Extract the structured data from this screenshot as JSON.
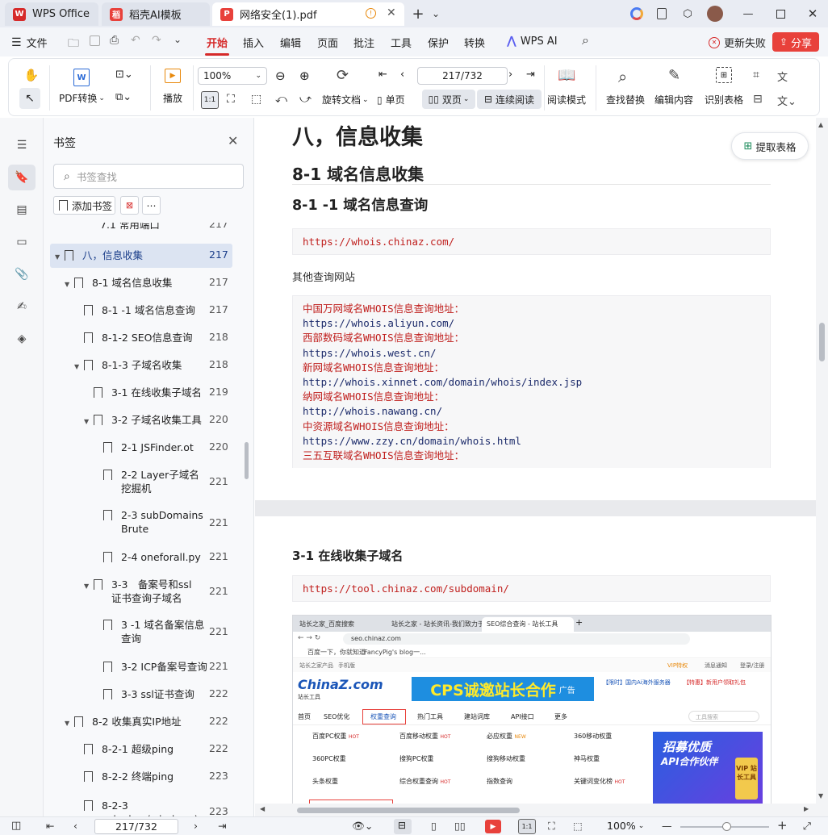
{
  "titlebar": {
    "tabs": [
      {
        "label": "WPS Office",
        "color": "#d62a2a"
      },
      {
        "label": "稻壳AI模板",
        "color": "#e8413b"
      },
      {
        "label": "网络安全(1).pdf",
        "color": "#e8413b"
      }
    ],
    "new_tab": "+",
    "dropdown": "⌄"
  },
  "menubar": {
    "file": "文件",
    "items": [
      "开始",
      "插入",
      "编辑",
      "页面",
      "批注",
      "工具",
      "保护",
      "转换"
    ],
    "active": "开始",
    "wps_ai": "WPS AI",
    "update_failed": "更新失败",
    "share": "分享"
  },
  "toolbar": {
    "pdf_convert": "PDF转换",
    "play": "播放",
    "zoom": "100%",
    "page_input": "217/732",
    "rotate": "旋转文档",
    "single_page": "单页",
    "double_page": "双页",
    "continuous": "连续阅读",
    "reading_mode": "阅读模式",
    "find_replace": "查找替换",
    "edit_content": "编辑内容",
    "recognize_table": "识别表格"
  },
  "panel": {
    "title": "书签",
    "search_placeholder": "书签查找",
    "add_bookmark": "添加书签",
    "items": [
      {
        "label": "7.1 常用端口",
        "page": "217"
      },
      {
        "label": "八，信息收集",
        "page": "217"
      },
      {
        "label": "8-1 域名信息收集",
        "page": "217"
      },
      {
        "label": "8-1 -1 域名信息查询",
        "page": "217"
      },
      {
        "label": "8-1-2 SEO信息查询",
        "page": "218"
      },
      {
        "label": "8-1-3 子域名收集",
        "page": "218"
      },
      {
        "label": "3-1 在线收集子域名",
        "page": "219"
      },
      {
        "label": "3-2 子域名收集工具",
        "page": "220"
      },
      {
        "label": "2-1 JSFinder.ot",
        "page": "220"
      },
      {
        "label": "2-2 Layer子域名挖掘机",
        "page": "221"
      },
      {
        "label": "2-3 subDomainsBrute",
        "page": "221"
      },
      {
        "label": "2-4 oneforall.py",
        "page": "221"
      },
      {
        "label": "3-3　备案号和ssl证书查询子域名",
        "page": "221"
      },
      {
        "label": "3 -1 域名备案信息查询",
        "page": "221"
      },
      {
        "label": "3-2 ICP备案号查询",
        "page": "221"
      },
      {
        "label": "3-3 ssl证书查询",
        "page": "222"
      },
      {
        "label": "8-2 收集真实IP地址",
        "page": "222"
      },
      {
        "label": "8-2-1 超级ping",
        "page": "222"
      },
      {
        "label": "8-2-2 终端ping",
        "page": "223"
      },
      {
        "label": "8-2-3 nslookup(windows)",
        "page": "223"
      }
    ]
  },
  "doc": {
    "h1": "八，信息收集",
    "h2": "8-1 域名信息收集",
    "h3": "8-1 -1 域名信息查询",
    "url1": "https://whois.chinaz.com/",
    "other_sites": "其他查询网站",
    "whois_lines": [
      "中国万网域名WHOIS信息查询地址：",
      "https://whois.aliyun.com/",
      "西部数码域名WHOIS信息查询地址：",
      "https://whois.west.cn/",
      "新网域名WHOIS信息查询地址：",
      "http://whois.xinnet.com/domain/whois/index.jsp",
      "纳网域名WHOIS信息查询地址：",
      "http://whois.nawang.cn/",
      "中资源域名WHOIS信息查询地址：",
      "https://www.zzy.cn/domain/whois.html",
      "三五互联域名WHOIS信息查询地址："
    ],
    "h3b": "3-1 在线收集子域名",
    "url2": "https://tool.chinaz.com/subdomain/",
    "extract_table": "提取表格",
    "shot": {
      "tab1": "站长之家_百度搜索",
      "tab2": "站长之家 - 站长资讯-我们致力于",
      "tab3": "SEO综合查询 - 站长工具",
      "address": "seo.chinaz.com",
      "bookmark1": "百度一下，你就知道",
      "bookmark2": "FancyPig's blog一...",
      "topnav1": "站长之家产品",
      "topnav2": "手机版",
      "vip": "VIP特权",
      "msg": "消息通知",
      "login": "登录/注册",
      "logo": "ChinaZ.com",
      "logo_sub": "站长工具",
      "banner": "CPS诚邀站长合作",
      "banner_tag": "广告",
      "ad1": "【限时】国内Ai海外服务器",
      "ad2": "【特惠】新用户领取礼包",
      "nav": [
        "首页",
        "SEO优化",
        "权重查询",
        "热门工具",
        "建站词库",
        "API接口",
        "更多"
      ],
      "search_hint": "工具搜索",
      "grid": [
        [
          "百度PC权重",
          "HOT"
        ],
        [
          "百度移动权重",
          "HOT"
        ],
        [
          "必应权重",
          "NEW"
        ],
        [
          "360移动权重",
          ""
        ],
        [
          "360PC权重",
          ""
        ],
        [
          "搜狗PC权重",
          ""
        ],
        [
          "搜狗移动权重",
          ""
        ],
        [
          "神马权重",
          ""
        ],
        [
          "头条权重",
          ""
        ],
        [
          "综合权重查询",
          "HOT"
        ],
        [
          "指数查询",
          ""
        ],
        [
          "关键词变化榜",
          "HOT"
        ]
      ],
      "promo1": "招募优质",
      "promo2": "API合作伙伴",
      "promo_badge": "VIP 站长工具"
    }
  },
  "status": {
    "page": "217/732",
    "zoom": "100%"
  },
  "colors": {
    "accent": "#d62a2a",
    "share_bg": "#e8413b",
    "selected_bookmark_bg": "#dce4f2"
  }
}
